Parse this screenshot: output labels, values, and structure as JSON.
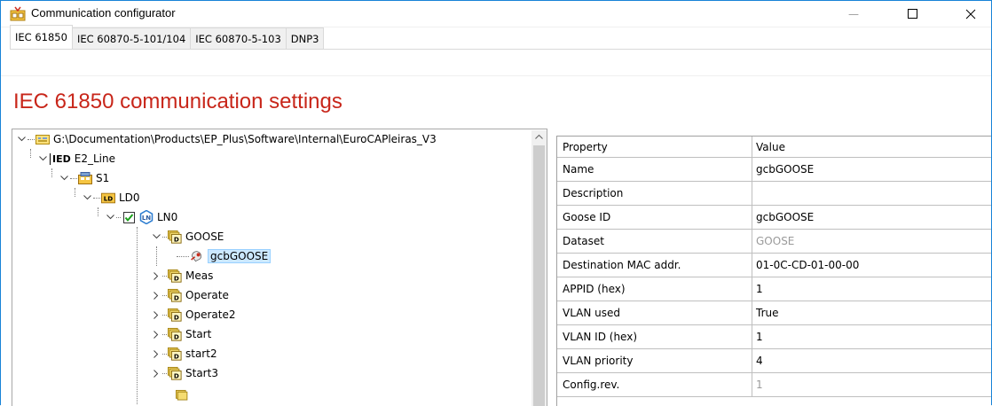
{
  "window": {
    "title": "Communication configurator",
    "minimize_glyph": "—",
    "maximize_glyph": "☐",
    "close_glyph": "✕"
  },
  "tabs": [
    {
      "label": "IEC 61850",
      "active": true
    },
    {
      "label": "IEC 60870-5-101/104",
      "active": false
    },
    {
      "label": "IEC 60870-5-103",
      "active": false
    },
    {
      "label": "DNP3",
      "active": false
    }
  ],
  "heading": "IEC 61850 communication settings",
  "colors": {
    "heading": "#c8261a",
    "selection": "#cce8ff",
    "window_border": "#1883d7"
  },
  "tree": {
    "root": {
      "label": "G:\\Documentation\\Products\\EP_Plus\\Software\\Internal\\EuroCAPleiras_V3",
      "icon": "project-icon"
    },
    "ied": {
      "prefix": "IED",
      "label": "E2_Line"
    },
    "server": {
      "label": "S1",
      "icon": "server-icon"
    },
    "ld": {
      "label": "LD0",
      "icon_text": "LD"
    },
    "ln": {
      "label": "LN0",
      "icon_text": "LN",
      "checked": true
    },
    "dataset_icon_text": "D",
    "goose": {
      "label": "GOOSE"
    },
    "gcb": {
      "label": "gcbGOOSE",
      "selected": true
    },
    "children": [
      {
        "label": "Meas"
      },
      {
        "label": "Operate"
      },
      {
        "label": "Operate2"
      },
      {
        "label": "Start"
      },
      {
        "label": "start2"
      },
      {
        "label": "Start3"
      }
    ]
  },
  "properties": {
    "header": {
      "property": "Property",
      "value": "Value"
    },
    "rows": [
      {
        "name": "Name",
        "value": "gcbGOOSE",
        "dim": false
      },
      {
        "name": "Description",
        "value": "",
        "dim": false
      },
      {
        "name": "Goose ID",
        "value": "gcbGOOSE",
        "dim": false
      },
      {
        "name": "Dataset",
        "value": "GOOSE",
        "dim": true
      },
      {
        "name": "Destination MAC addr.",
        "value": "01-0C-CD-01-00-00",
        "dim": false
      },
      {
        "name": "APPID (hex)",
        "value": "1",
        "dim": false
      },
      {
        "name": "VLAN used",
        "value": "True",
        "dim": false
      },
      {
        "name": "VLAN ID (hex)",
        "value": "1",
        "dim": false
      },
      {
        "name": "VLAN priority",
        "value": "4",
        "dim": false
      },
      {
        "name": "Config.rev.",
        "value": "1",
        "dim": true
      }
    ]
  }
}
